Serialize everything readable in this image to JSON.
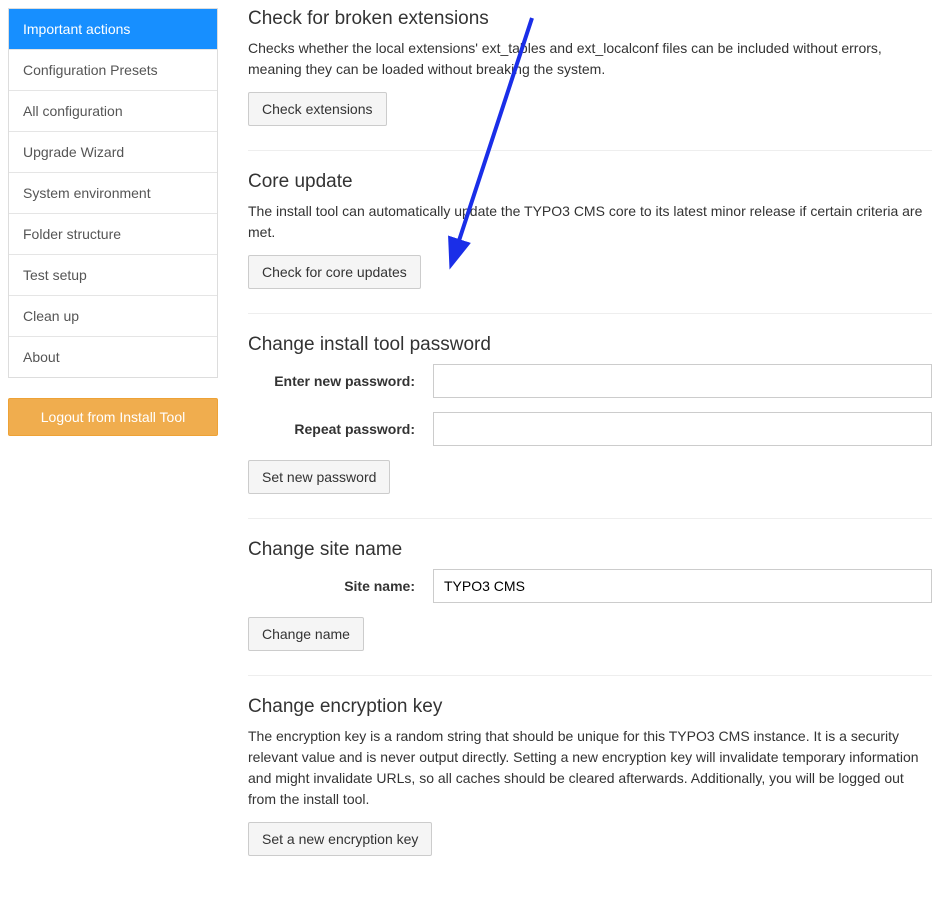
{
  "sidebar": {
    "items": [
      {
        "label": "Important actions",
        "active": true
      },
      {
        "label": "Configuration Presets",
        "active": false
      },
      {
        "label": "All configuration",
        "active": false
      },
      {
        "label": "Upgrade Wizard",
        "active": false
      },
      {
        "label": "System environment",
        "active": false
      },
      {
        "label": "Folder structure",
        "active": false
      },
      {
        "label": "Test setup",
        "active": false
      },
      {
        "label": "Clean up",
        "active": false
      },
      {
        "label": "About",
        "active": false
      }
    ],
    "logout_label": "Logout from Install Tool"
  },
  "sections": {
    "broken_ext": {
      "heading": "Check for broken extensions",
      "desc": "Checks whether the local extensions' ext_tables and ext_localconf files can be included without errors, meaning they can be loaded without breaking the system.",
      "button": "Check extensions"
    },
    "core_update": {
      "heading": "Core update",
      "desc": "The install tool can automatically update the TYPO3 CMS core to its latest minor release if certain criteria are met.",
      "button": "Check for core updates"
    },
    "password": {
      "heading": "Change install tool password",
      "label_new": "Enter new password:",
      "label_repeat": "Repeat password:",
      "value_new": "",
      "value_repeat": "",
      "button": "Set new password"
    },
    "sitename": {
      "heading": "Change site name",
      "label": "Site name:",
      "value": "TYPO3 CMS",
      "button": "Change name"
    },
    "encryption": {
      "heading": "Change encryption key",
      "desc": "The encryption key is a random string that should be unique for this TYPO3 CMS instance. It is a security relevant value and is never output directly. Setting a new encryption key will invalidate temporary information and might invalidate URLs, so all caches should be cleared afterwards. Additionally, you will be logged out from the install tool.",
      "button": "Set a new encryption key"
    }
  },
  "annotation": {
    "arrow_color": "#1a2ee8"
  }
}
